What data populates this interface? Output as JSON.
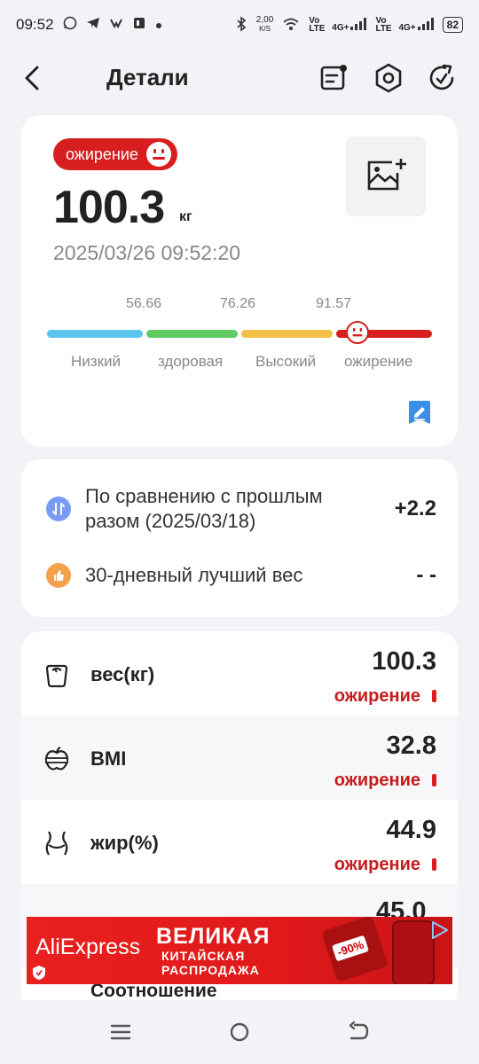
{
  "status_bar": {
    "time": "09:52",
    "net_speed_value": "2,00",
    "net_speed_unit": "K/S",
    "volte1": "Vo LTE",
    "signal1": "4G+",
    "volte2": "Vo LTE",
    "signal2": "4G+",
    "battery": "82",
    "left_icons": [
      "whatsapp-icon",
      "telegram-icon",
      "vk-icon",
      "app-icon",
      "dot-icon"
    ],
    "right_icons": [
      "bluetooth-icon",
      "wifi-icon",
      "signal-icon",
      "battery-icon"
    ]
  },
  "header": {
    "title": "Детали",
    "icons": [
      "back-icon",
      "report-icon",
      "settings-icon",
      "refresh-icon"
    ]
  },
  "summary": {
    "badge": "ожирение",
    "weight": "100.3",
    "unit": "кг",
    "datetime": "2025/03/26 09:52:20",
    "thresholds": [
      "56.66",
      "76.26",
      "91.57"
    ],
    "ranges": [
      "Низкий",
      "здоровая",
      "Высокий",
      "ожирение"
    ],
    "range_colors": [
      "#5cc4ef",
      "#5fcb63",
      "#f2c146",
      "#d81e1e"
    ]
  },
  "comparison": {
    "prev_label": "По сравнению с прошлым разом (2025/03/18)",
    "prev_label_line1": "По сравнению с прошлым",
    "prev_label_line2": "разом (2025/03/18)",
    "prev_value": "+2.2",
    "best_label": "30-дневный лучший вес",
    "best_value": "- -"
  },
  "metrics": [
    {
      "name": "вес(кг)",
      "value": "100.3",
      "status": "ожирение",
      "icon": "scale-icon"
    },
    {
      "name": "BMI",
      "value": "32.8",
      "status": "ожирение",
      "icon": "apple-tape-icon"
    },
    {
      "name": "жир(%)",
      "value": "44.9",
      "status": "ожирение",
      "icon": "waist-icon"
    }
  ],
  "partial_metric": {
    "value": "45.0",
    "name": "Соотношение"
  },
  "ad": {
    "brand": "AliExpress",
    "line1": "ВЕЛИКАЯ",
    "line2": "КИТАЙСКАЯ",
    "line3": "РАСПРОДАЖА",
    "promo": "-90%"
  },
  "nav": {
    "icons": [
      "menu-icon",
      "home-icon",
      "back-nav-icon"
    ]
  },
  "colors": {
    "accent_red": "#d81e1e",
    "status_red": "#c71c1c",
    "edit_blue": "#3a8ee6"
  }
}
